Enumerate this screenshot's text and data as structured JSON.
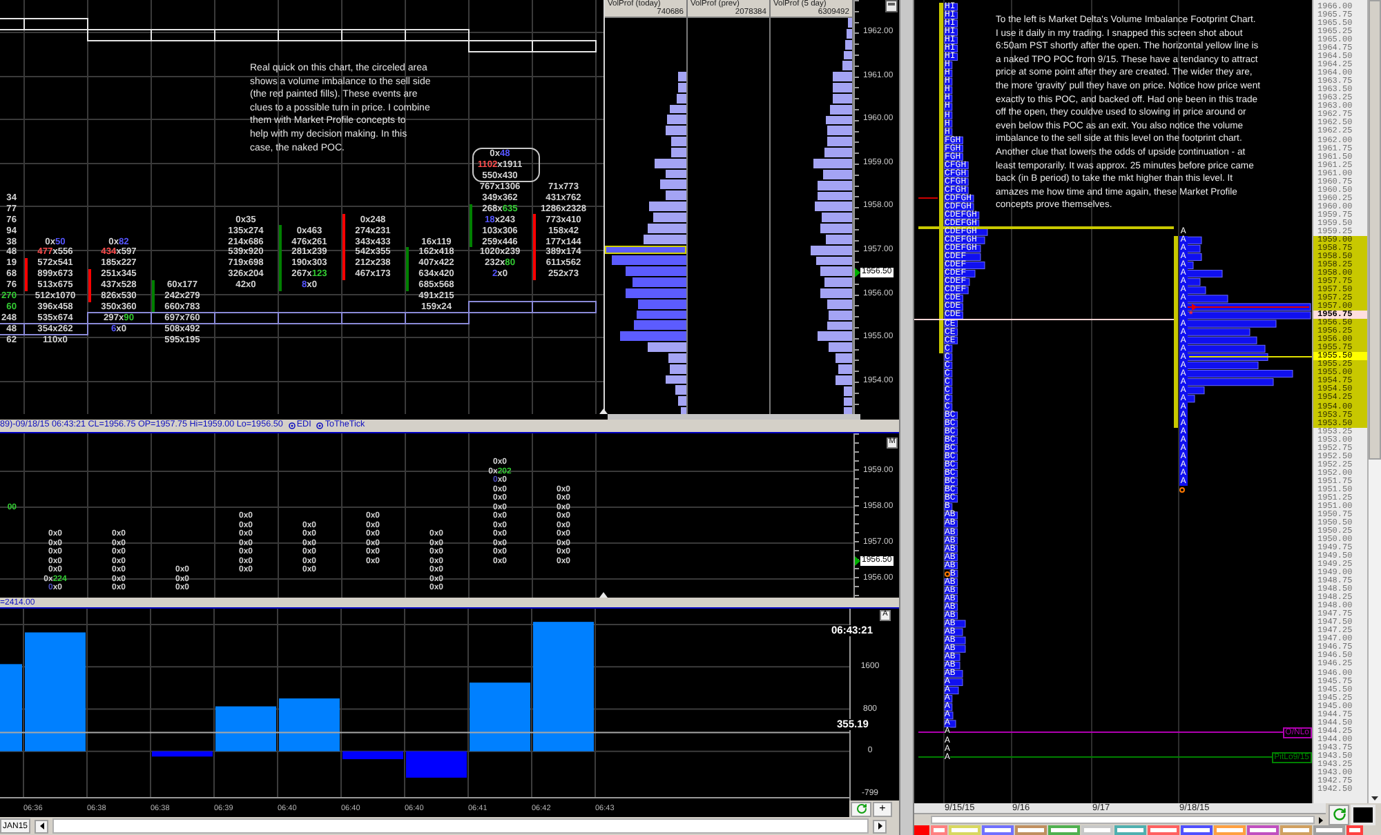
{
  "footprint_chart": {
    "annotation": "Real quick on this chart, the circeled area\nshows a volume imbalance to the sell side\n(the red painted fills). These events are\nclues to a possible turn in price. I combine\nthem with Market Profile concepts to\nhelp with my decision making. In this\ncase, the naked POC.",
    "columns": [
      {
        "cells": [
          null,
          null,
          null,
          null,
          {
            "text": "34"
          },
          {
            "text": "77"
          },
          {
            "text": "76"
          },
          {
            "text": "94"
          },
          {
            "text": "38"
          },
          {
            "text": "48"
          },
          {
            "text": "19"
          },
          {
            "text": "68"
          },
          {
            "text": "76"
          },
          {
            "parts": [
              {
                "text": "270",
                "color": "#33cc33"
              }
            ]
          },
          {
            "parts": [
              {
                "text": "60",
                "color": "#33cc33"
              }
            ]
          },
          {
            "text": "248"
          },
          {
            "text": "48"
          },
          {
            "text": "62"
          }
        ]
      },
      {
        "color": "#ff0000",
        "cells": [
          null,
          null,
          null,
          null,
          null,
          null,
          null,
          null,
          {
            "parts": [
              {
                "text": "0x"
              },
              {
                "text": "50",
                "color": "#5555ff"
              }
            ]
          },
          {
            "parts": [
              {
                "text": "477",
                "color": "#ff4d4d"
              },
              {
                "text": "x556"
              }
            ]
          },
          {
            "text": "572x541"
          },
          {
            "text": "899x673"
          },
          {
            "text": "513x675"
          },
          {
            "text": "512x1070"
          },
          {
            "text": "396x458"
          },
          {
            "text": "535x674"
          },
          {
            "text": "354x262"
          },
          {
            "text": "110x0"
          }
        ]
      },
      {
        "color": "#ff0000",
        "cells": [
          null,
          null,
          null,
          null,
          null,
          null,
          null,
          null,
          {
            "parts": [
              {
                "text": "0x"
              },
              {
                "text": "82",
                "color": "#5555ff"
              }
            ]
          },
          {
            "parts": [
              {
                "text": "434",
                "color": "#ff4d4d"
              },
              {
                "text": "x597"
              }
            ]
          },
          {
            "text": "185x227"
          },
          {
            "text": "251x345"
          },
          {
            "text": "437x528"
          },
          {
            "text": "826x530"
          },
          {
            "text": "350x360"
          },
          {
            "parts": [
              {
                "text": "297x"
              },
              {
                "text": "90",
                "color": "#33cc33"
              }
            ]
          },
          {
            "parts": [
              {
                "text": "6",
                "color": "#5555ff"
              },
              {
                "text": "x0"
              }
            ]
          }
        ]
      },
      {
        "color": "#008000",
        "cells": [
          null,
          null,
          null,
          null,
          null,
          null,
          null,
          null,
          null,
          null,
          null,
          null,
          {
            "text": "60x177"
          },
          {
            "text": "242x279"
          },
          {
            "text": "660x783"
          },
          {
            "text": "697x760"
          },
          {
            "text": "508x492"
          },
          {
            "text": "595x195"
          }
        ]
      },
      {
        "cells": [
          null,
          null,
          null,
          null,
          null,
          null,
          {
            "text": "0x35"
          },
          {
            "text": "135x274"
          },
          {
            "text": "214x686"
          },
          {
            "text": "539x920"
          },
          {
            "text": "719x698"
          },
          {
            "text": "326x204"
          },
          {
            "text": "42x0"
          }
        ]
      },
      {
        "color": "#008000",
        "cells": [
          null,
          null,
          null,
          null,
          null,
          null,
          null,
          {
            "text": "0x463"
          },
          {
            "text": "476x261"
          },
          {
            "text": "281x239"
          },
          {
            "text": "190x303"
          },
          {
            "parts": [
              {
                "text": "267x"
              },
              {
                "text": "123",
                "color": "#33cc33"
              }
            ]
          },
          {
            "parts": [
              {
                "text": "8",
                "color": "#5555ff"
              },
              {
                "text": "x0"
              }
            ]
          }
        ]
      },
      {
        "color": "#ff0000",
        "cells": [
          null,
          null,
          null,
          null,
          null,
          null,
          {
            "text": "0x248"
          },
          {
            "text": "274x231"
          },
          {
            "text": "343x433"
          },
          {
            "text": "542x355"
          },
          {
            "text": "212x238"
          },
          {
            "text": "467x173"
          }
        ]
      },
      {
        "color": "#008000",
        "cells": [
          null,
          null,
          null,
          null,
          null,
          null,
          null,
          null,
          {
            "text": "16x119"
          },
          {
            "text": "162x418"
          },
          {
            "text": "407x422"
          },
          {
            "text": "634x420"
          },
          {
            "text": "685x568"
          },
          {
            "text": "491x215"
          },
          {
            "text": "159x24"
          }
        ]
      },
      {
        "color": "#008000",
        "cells": [
          {
            "parts": [
              {
                "text": "0x"
              },
              {
                "text": "48",
                "color": "#5555ff"
              }
            ],
            "circled": true
          },
          {
            "parts": [
              {
                "text": "1102",
                "color": "#ff4d4d"
              },
              {
                "text": "x1911"
              }
            ],
            "circled": true
          },
          {
            "text": "550x430",
            "circled": true
          },
          {
            "text": "767x1306"
          },
          {
            "text": "349x362"
          },
          {
            "parts": [
              {
                "text": "268x"
              },
              {
                "text": "635",
                "color": "#33cc33"
              }
            ]
          },
          {
            "parts": [
              {
                "text": "18",
                "color": "#5555ff"
              },
              {
                "text": "x243"
              }
            ]
          },
          {
            "text": "103x306"
          },
          {
            "text": "259x446"
          },
          {
            "text": "1020x239"
          },
          {
            "parts": [
              {
                "text": "232x"
              },
              {
                "text": "80",
                "color": "#33cc33"
              }
            ]
          },
          {
            "parts": [
              {
                "text": "2",
                "color": "#5555ff"
              },
              {
                "text": "x0"
              }
            ]
          }
        ]
      },
      {
        "color": "#ff0000",
        "cells": [
          null,
          null,
          null,
          {
            "text": "71x773"
          },
          {
            "text": "431x762"
          },
          {
            "text": "1286x2328"
          },
          {
            "text": "773x410"
          },
          {
            "text": "158x42"
          },
          {
            "text": "177x144"
          },
          {
            "text": "389x174"
          },
          {
            "text": "611x562"
          },
          {
            "text": "252x73"
          }
        ]
      }
    ],
    "volume_profiles": [
      {
        "title": "VolProf (today)",
        "total": "740686"
      },
      {
        "title": "VolProf (prev)",
        "total": "2078384"
      },
      {
        "title": "VolProf (5 day)",
        "total": "6309492"
      }
    ],
    "price_axis": [
      "1962.00",
      "1961.00",
      "1960.00",
      "1959.00",
      "1958.00",
      "1957.00",
      "1956.00",
      "1955.00",
      "1954.00"
    ],
    "last_price": "1956.50"
  },
  "status_bar": {
    "text": "89)-09/18/15 06:43:21 CL=1956.75 OP=1957.75 Hi=1959.00 Lo=1956.50",
    "indicators": [
      "EDI",
      "ToTheTick"
    ]
  },
  "trades_chart": {
    "button": "M",
    "columns": [
      {
        "cells": [
          null,
          null,
          null,
          null,
          null,
          {
            "parts": [
              {
                "text": "00",
                "color": "#33cc33"
              }
            ]
          }
        ]
      },
      {
        "cells": [
          null,
          null,
          null,
          null,
          null,
          null,
          null,
          null,
          {
            "text": "0x0"
          },
          {
            "text": "0x0"
          },
          {
            "text": "0x0"
          },
          {
            "text": "0x0"
          },
          {
            "text": "0x0"
          },
          {
            "parts": [
              {
                "text": "0x"
              },
              {
                "text": "224",
                "color": "#33cc33"
              }
            ]
          },
          {
            "parts": [
              {
                "text": "0",
                "color": "#5050c0"
              },
              {
                "text": "x0"
              }
            ]
          }
        ]
      },
      {
        "cells": [
          null,
          null,
          null,
          null,
          null,
          null,
          null,
          null,
          {
            "text": "0x0"
          },
          {
            "text": "0x0"
          },
          {
            "text": "0x0"
          },
          {
            "text": "0x0"
          },
          {
            "text": "0x0"
          },
          {
            "text": "0x0"
          },
          {
            "text": "0x0"
          }
        ]
      },
      {
        "cells": [
          null,
          null,
          null,
          null,
          null,
          null,
          null,
          null,
          null,
          null,
          null,
          null,
          {
            "text": "0x0"
          },
          {
            "text": "0x0"
          },
          {
            "text": "0x0"
          }
        ]
      },
      {
        "cells": [
          null,
          null,
          null,
          null,
          null,
          null,
          {
            "text": "0x0"
          },
          {
            "text": "0x0"
          },
          {
            "text": "0x0"
          },
          {
            "text": "0x0"
          },
          {
            "text": "0x0"
          },
          {
            "text": "0x0"
          },
          {
            "text": "0x0"
          }
        ]
      },
      {
        "cells": [
          null,
          null,
          null,
          null,
          null,
          null,
          null,
          {
            "text": "0x0"
          },
          {
            "text": "0x0"
          },
          {
            "text": "0x0"
          },
          {
            "text": "0x0"
          },
          {
            "text": "0x0"
          },
          {
            "text": "0x0"
          }
        ]
      },
      {
        "cells": [
          null,
          null,
          null,
          null,
          null,
          null,
          {
            "text": "0x0"
          },
          {
            "text": "0x0"
          },
          {
            "text": "0x0"
          },
          {
            "text": "0x0"
          },
          {
            "text": "0x0"
          },
          {
            "text": "0x0"
          }
        ]
      },
      {
        "cells": [
          null,
          null,
          null,
          null,
          null,
          null,
          null,
          null,
          {
            "text": "0x0"
          },
          {
            "text": "0x0"
          },
          {
            "text": "0x0"
          },
          {
            "text": "0x0"
          },
          {
            "text": "0x0"
          },
          {
            "text": "0x0"
          },
          {
            "text": "0x0"
          }
        ]
      },
      {
        "cells": [
          {
            "text": "0x0"
          },
          {
            "parts": [
              {
                "text": "0x"
              },
              {
                "text": "202",
                "color": "#33cc33"
              }
            ]
          },
          {
            "parts": [
              {
                "text": "0",
                "color": "#5050c0"
              },
              {
                "text": "x0"
              }
            ]
          },
          {
            "text": "0x0"
          },
          {
            "text": "0x0"
          },
          {
            "text": "0x0"
          },
          {
            "text": "0x0"
          },
          {
            "text": "0x0"
          },
          {
            "text": "0x0"
          },
          {
            "text": "0x0"
          },
          {
            "text": "0x0"
          },
          {
            "text": "0x0"
          }
        ]
      },
      {
        "cells": [
          null,
          null,
          null,
          {
            "text": "0x0"
          },
          {
            "text": "0x0"
          },
          {
            "text": "0x0"
          },
          {
            "text": "0x0"
          },
          {
            "text": "0x0"
          },
          {
            "text": "0x0"
          },
          {
            "text": "0x0"
          },
          {
            "text": "0x0"
          },
          {
            "text": "0x0"
          }
        ]
      }
    ],
    "price_axis": [
      "1959.00",
      "1958.00",
      "1957.00",
      "1956.00"
    ],
    "last_price": "1956.50"
  },
  "study_bar": {
    "text": "=2414.00"
  },
  "delta_chart": {
    "button": "A",
    "time": "06:43:21",
    "average_label": "355.19",
    "value_labels": [
      "1600",
      "800",
      "0",
      "-799"
    ],
    "time_labels": [
      "06:36",
      "06:38",
      "06:38",
      "06:39",
      "06:40",
      "06:40",
      "06:40",
      "06:41",
      "06:42",
      "06:43"
    ]
  },
  "time_scroll": {
    "contract": "JAN15",
    "button": "+"
  },
  "profile_chart": {
    "annotation": "To the left is Market Delta's Volume Imbalance Footprint Chart.\nI use it daily in my trading. I snapped this screen shot about\n6:50am PST shortly after the open. The horizontal yellow line is\na naked TPO POC from 9/15. These have a tendancy to attract\nprice at some point after they are created. The wider they are,\nthe more 'gravity' pull they have on price. Notice how price went\nexactly to this POC, and backed off. Had one been in this trade\noff the open, they couldve used to slowing in price around or\neven below this POC as an exit. You also notice the volume\nimbalance to the sell side at this level on the footprint chart.\nAnother clue that lowers the odds of upside continuation - at\nleast temporarily. It was approx. 25 minutes before price came\nback (in B period) to take the mkt higher than this level. It\namazes me how time and time again, these Market Profile\nconcepts prove themselves.",
    "ladder": [
      {
        "price": "1966.00",
        "kind": "plain",
        "left": "HI"
      },
      {
        "price": "1965.75",
        "kind": "plain",
        "left": "HI"
      },
      {
        "price": "1965.50",
        "kind": "plain",
        "left": "HI"
      },
      {
        "price": "1965.25",
        "kind": "plain",
        "left": "HI"
      },
      {
        "price": "1965.00",
        "kind": "plain",
        "left": "HI"
      },
      {
        "price": "1964.75",
        "kind": "plain",
        "left": "HI"
      },
      {
        "price": "1964.50",
        "kind": "plain",
        "left": "HI"
      },
      {
        "price": "1964.25",
        "kind": "plain",
        "left": "H"
      },
      {
        "price": "1964.00",
        "kind": "plain",
        "left": "H"
      },
      {
        "price": "1963.75",
        "kind": "plain",
        "left": "H"
      },
      {
        "price": "1963.50",
        "kind": "plain",
        "left": "H"
      },
      {
        "price": "1963.25",
        "kind": "plain",
        "left": "H"
      },
      {
        "price": "1963.00",
        "kind": "plain",
        "left": "H"
      },
      {
        "price": "1962.75",
        "kind": "plain",
        "left": "H"
      },
      {
        "price": "1962.50",
        "kind": "plain",
        "left": "H"
      },
      {
        "price": "1962.25",
        "kind": "plain",
        "left": "H"
      },
      {
        "price": "1962.00",
        "kind": "plain",
        "left": "FGH"
      },
      {
        "price": "1961.75",
        "kind": "plain",
        "left": "FGH"
      },
      {
        "price": "1961.50",
        "kind": "plain",
        "left": "FGH"
      },
      {
        "price": "1961.25",
        "kind": "plain",
        "left": "CFGH"
      },
      {
        "price": "1961.00",
        "kind": "plain",
        "left": "CFGH"
      },
      {
        "price": "1960.75",
        "kind": "plain",
        "left": "CFGH"
      },
      {
        "price": "1960.50",
        "kind": "plain",
        "left": "CFGH"
      },
      {
        "price": "1960.25",
        "kind": "plain",
        "left": "CDFGH",
        "dash": true
      },
      {
        "price": "1960.00",
        "kind": "plain",
        "left": "CDFGH"
      },
      {
        "price": "1959.75",
        "kind": "plain",
        "left": "CDEFGH"
      },
      {
        "price": "1959.50",
        "kind": "plain",
        "left": "CDEFGH"
      },
      {
        "price": "1959.25",
        "kind": "plain",
        "left": "CDEFGH",
        "naked_poc": true,
        "right": "A"
      },
      {
        "price": "1959.00",
        "kind": "value_area",
        "left": "CDEFGH",
        "right": "A"
      },
      {
        "price": "1958.75",
        "kind": "value_area",
        "left": "CDEFGH",
        "right": "A"
      },
      {
        "price": "1958.50",
        "kind": "value_area",
        "left": "CDEF",
        "right": "A"
      },
      {
        "price": "1958.25",
        "kind": "value_area",
        "left": "CDEF",
        "right": "A"
      },
      {
        "price": "1958.00",
        "kind": "value_area",
        "left": "CDEF",
        "right": "A"
      },
      {
        "price": "1957.75",
        "kind": "value_area",
        "left": "CDEF",
        "right": "A"
      },
      {
        "price": "1957.50",
        "kind": "value_area",
        "left": "CDEF",
        "right": "A"
      },
      {
        "price": "1957.25",
        "kind": "value_area",
        "left": "CDE",
        "right": "A"
      },
      {
        "price": "1957.00",
        "kind": "value_area",
        "left": "CDE",
        "right": "A",
        "arrow": true
      },
      {
        "price": "1956.75",
        "kind": "last",
        "left": "CDE",
        "right": "A",
        "right_mark": "*"
      },
      {
        "price": "1956.50",
        "kind": "value_area",
        "left": "CE",
        "right": "A"
      },
      {
        "price": "1956.25",
        "kind": "value_area",
        "left": "CE",
        "right": "A"
      },
      {
        "price": "1956.00",
        "kind": "value_area",
        "left": "CE",
        "right": "A"
      },
      {
        "price": "1955.75",
        "kind": "value_area",
        "left": "C",
        "right": "A"
      },
      {
        "price": "1955.50",
        "kind": "poc",
        "left": "C",
        "right": "A"
      },
      {
        "price": "1955.25",
        "kind": "value_area",
        "left": "C",
        "right": "A"
      },
      {
        "price": "1955.00",
        "kind": "value_area",
        "left": "C",
        "right": "A"
      },
      {
        "price": "1954.75",
        "kind": "value_area",
        "left": "C",
        "right": "A"
      },
      {
        "price": "1954.50",
        "kind": "value_area",
        "left": "C",
        "right": "A"
      },
      {
        "price": "1954.25",
        "kind": "value_area",
        "left": "C",
        "right": "A"
      },
      {
        "price": "1954.00",
        "kind": "value_area",
        "left": "C",
        "right": "A"
      },
      {
        "price": "1953.75",
        "kind": "value_area",
        "left": "BC",
        "right": "A"
      },
      {
        "price": "1953.50",
        "kind": "value_area",
        "left": "BC",
        "right": "A"
      },
      {
        "price": "1953.25",
        "kind": "plain",
        "left": "BC",
        "right": "A"
      },
      {
        "price": "1953.00",
        "kind": "plain",
        "left": "BC",
        "right": "A"
      },
      {
        "price": "1952.75",
        "kind": "plain",
        "left": "BC",
        "right": "A"
      },
      {
        "price": "1952.50",
        "kind": "plain",
        "left": "BC",
        "right": "A"
      },
      {
        "price": "1952.25",
        "kind": "plain",
        "left": "BC",
        "right": "A"
      },
      {
        "price": "1952.00",
        "kind": "plain",
        "left": "BC",
        "right": "A"
      },
      {
        "price": "1951.75",
        "kind": "plain",
        "left": "BC",
        "right": "A"
      },
      {
        "price": "1951.50",
        "kind": "plain",
        "left": "BC",
        "right_open": true
      },
      {
        "price": "1951.25",
        "kind": "plain",
        "left": "BC"
      },
      {
        "price": "1951.00",
        "kind": "plain",
        "left": "B"
      },
      {
        "price": "1950.75",
        "kind": "plain",
        "left": "AB"
      },
      {
        "price": "1950.50",
        "kind": "plain",
        "left": "AB"
      },
      {
        "price": "1950.25",
        "kind": "plain",
        "left": "AB"
      },
      {
        "price": "1950.00",
        "kind": "plain",
        "left": "AB"
      },
      {
        "price": "1949.75",
        "kind": "plain",
        "left": "AB"
      },
      {
        "price": "1949.50",
        "kind": "plain",
        "left": "AB"
      },
      {
        "price": "1949.25",
        "kind": "plain",
        "left": "AB"
      },
      {
        "price": "1949.00",
        "kind": "plain",
        "left": "B",
        "left_open": true
      },
      {
        "price": "1948.75",
        "kind": "plain",
        "left": "AB"
      },
      {
        "price": "1948.50",
        "kind": "plain",
        "left": "AB"
      },
      {
        "price": "1948.25",
        "kind": "plain",
        "left": "AB"
      },
      {
        "price": "1948.00",
        "kind": "plain",
        "left": "AB"
      },
      {
        "price": "1947.75",
        "kind": "plain",
        "left": "AB"
      },
      {
        "price": "1947.50",
        "kind": "plain",
        "left": "AB"
      },
      {
        "price": "1947.25",
        "kind": "plain",
        "left": "AB"
      },
      {
        "price": "1947.00",
        "kind": "plain",
        "left": "AB"
      },
      {
        "price": "1946.75",
        "kind": "plain",
        "left": "AB"
      },
      {
        "price": "1946.50",
        "kind": "plain",
        "left": "AB"
      },
      {
        "price": "1946.25",
        "kind": "plain",
        "left": "AB"
      },
      {
        "price": "1946.00",
        "kind": "plain",
        "left": "AB"
      },
      {
        "price": "1945.75",
        "kind": "plain",
        "left": "A"
      },
      {
        "price": "1945.50",
        "kind": "plain",
        "left": "A"
      },
      {
        "price": "1945.25",
        "kind": "plain",
        "left": "A"
      },
      {
        "price": "1945.00",
        "kind": "plain",
        "left": "A"
      },
      {
        "price": "1944.75",
        "kind": "plain",
        "left": "A"
      },
      {
        "price": "1944.50",
        "kind": "plain",
        "left": "A"
      },
      {
        "price": "1944.25",
        "kind": "plain",
        "left": "A",
        "line": {
          "label": "O/NLo",
          "color": "#b000b0"
        }
      },
      {
        "price": "1944.00",
        "kind": "plain",
        "left": "A"
      },
      {
        "price": "1943.75",
        "kind": "plain",
        "left": "A"
      },
      {
        "price": "1943.50",
        "kind": "plain",
        "left": "A",
        "line": {
          "label": "PitLo9/15",
          "color": "#008000"
        }
      },
      {
        "price": "1943.25",
        "kind": "plain"
      },
      {
        "price": "1943.00",
        "kind": "plain"
      },
      {
        "price": "1942.75",
        "kind": "plain"
      },
      {
        "price": "1942.50",
        "kind": "plain"
      }
    ],
    "dates": [
      "9/15/15",
      "9/16",
      "9/17",
      "9/18/15"
    ],
    "swatches": [
      {
        "color": "#ff0000",
        "filled": true
      },
      {
        "color": "#ff8080",
        "filled": false
      },
      {
        "color": "#d8d860",
        "filled": false
      },
      {
        "color": "#7070ff",
        "filled": false
      },
      {
        "color": "#c09060",
        "filled": false
      },
      {
        "color": "#50b050",
        "filled": false
      },
      {
        "color": "#c8c8c8",
        "filled": false
      },
      {
        "color": "#50b0b0",
        "filled": false
      },
      {
        "color": "#ff6060",
        "filled": false
      },
      {
        "color": "#5050ff",
        "filled": false
      },
      {
        "color": "#ffa040",
        "filled": false
      },
      {
        "color": "#c050c0",
        "filled": false
      },
      {
        "color": "#d0a060",
        "filled": false
      },
      {
        "color": "#a0a0a0",
        "filled": false
      },
      {
        "color": "#ff4040",
        "filled": false
      }
    ]
  }
}
